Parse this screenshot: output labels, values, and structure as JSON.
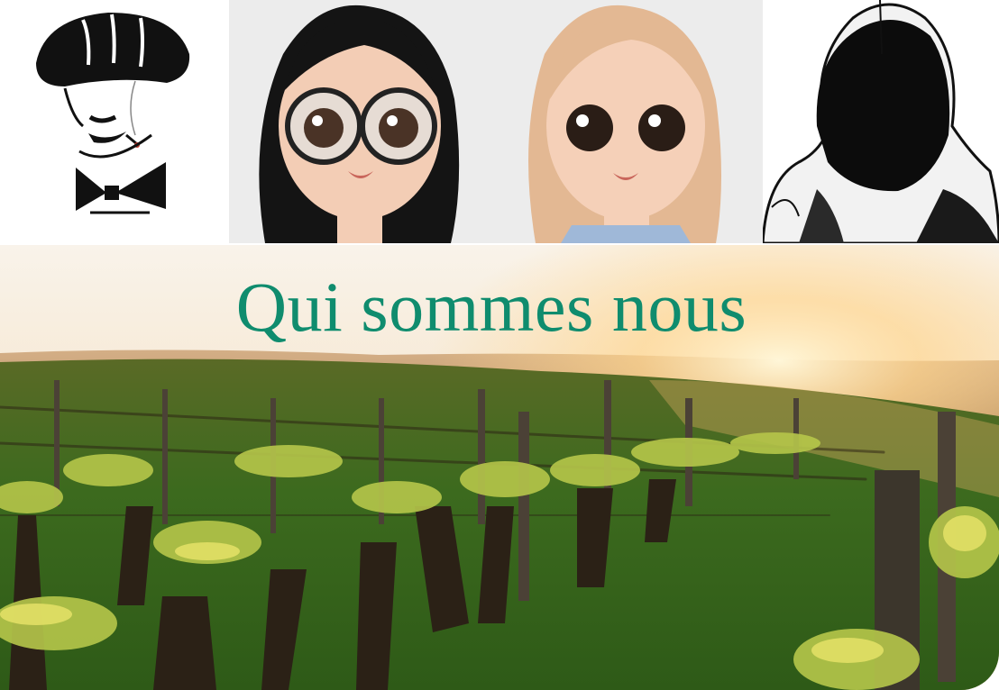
{
  "portraits": [
    {
      "name": "portrait-man-cap",
      "icon": "man-flat-cap-cigarette-illustration"
    },
    {
      "name": "portrait-doll-dark-hair-glasses",
      "icon": "doll-dark-hair-glasses-illustration"
    },
    {
      "name": "portrait-doll-blonde",
      "icon": "doll-blonde-illustration"
    },
    {
      "name": "portrait-hooded-figure",
      "icon": "hooded-figure-illustration"
    }
  ],
  "banner": {
    "title": "Qui sommes nous",
    "background": "vineyard-sunset-photo"
  },
  "colors": {
    "title": "#0f8c6e",
    "sky": "#f6e6cf",
    "grass": "#3f6b1f"
  }
}
